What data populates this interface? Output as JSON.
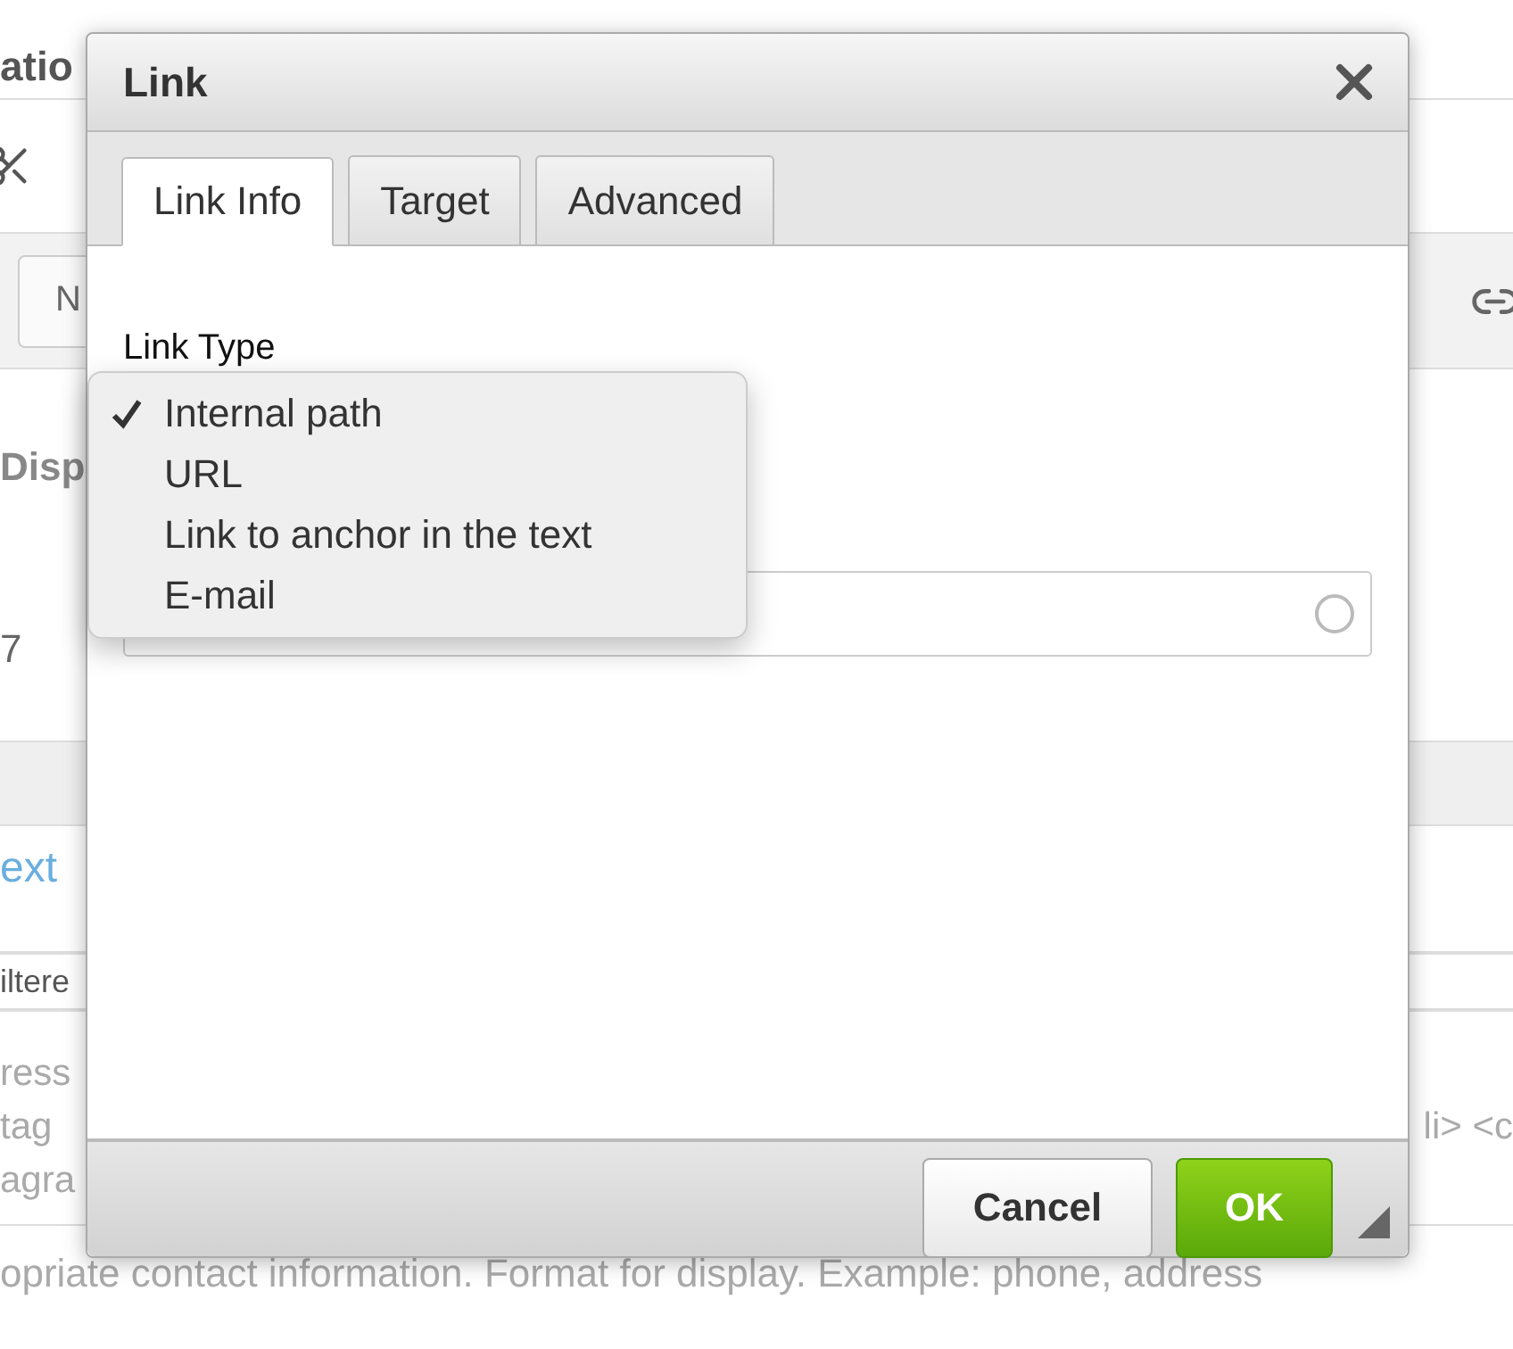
{
  "background": {
    "heading": "atio",
    "format_button": "N",
    "label": "Disp",
    "value": "7",
    "section_title": "ext",
    "select_value": "iltere",
    "help_lines": [
      {
        "left": "ress"
      },
      {
        "left": "tag",
        "right": "li> <c"
      },
      {
        "left": "agra"
      }
    ],
    "footer_text": "opriate contact information. Format for display. Example: phone, address"
  },
  "dialog": {
    "title": "Link",
    "tabs": [
      {
        "label": "Link Info",
        "selected": true
      },
      {
        "label": "Target",
        "selected": false
      },
      {
        "label": "Advanced",
        "selected": false
      }
    ],
    "link_type_label": "Link Type",
    "menu": [
      {
        "label": "Internal path",
        "checked": true
      },
      {
        "label": "URL",
        "checked": false
      },
      {
        "label": "Link to anchor in the text",
        "checked": false
      },
      {
        "label": "E-mail",
        "checked": false
      }
    ],
    "buttons": [
      {
        "label": "Cancel",
        "kind": "default"
      },
      {
        "label": "OK",
        "kind": "primary"
      }
    ]
  }
}
